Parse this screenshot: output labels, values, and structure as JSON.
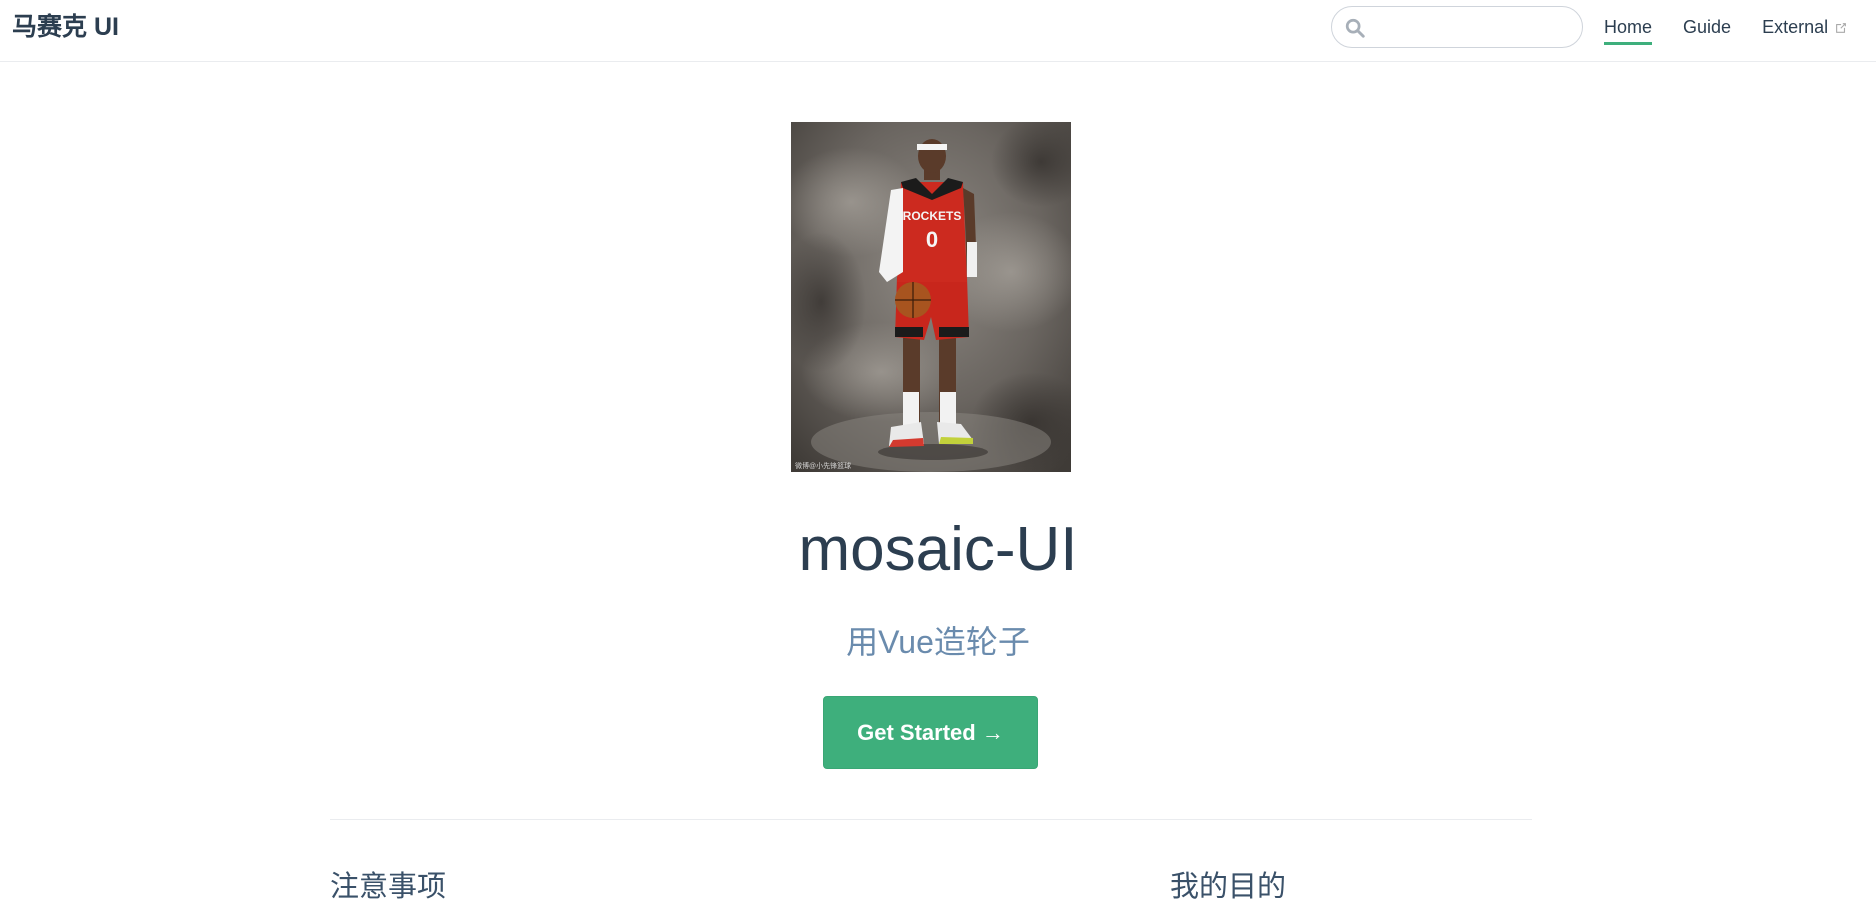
{
  "navbar": {
    "site_name": "马赛克 UI",
    "search": {
      "value": "",
      "placeholder": ""
    },
    "links": [
      {
        "label": "Home",
        "active": true
      },
      {
        "label": "Guide",
        "active": false
      },
      {
        "label": "External",
        "external": true
      }
    ]
  },
  "hero": {
    "image": "basketball-player-photo",
    "title": "mosaic-UI",
    "description": "用Vue造轮子",
    "action_label": "Get Started →"
  },
  "features": [
    {
      "title": "注意事项"
    },
    {
      "title": "我的目的"
    }
  ],
  "colors": {
    "accent": "#3eaf7c",
    "text": "#2c3e50",
    "description": "#6a8bad",
    "border": "#eaecef"
  }
}
